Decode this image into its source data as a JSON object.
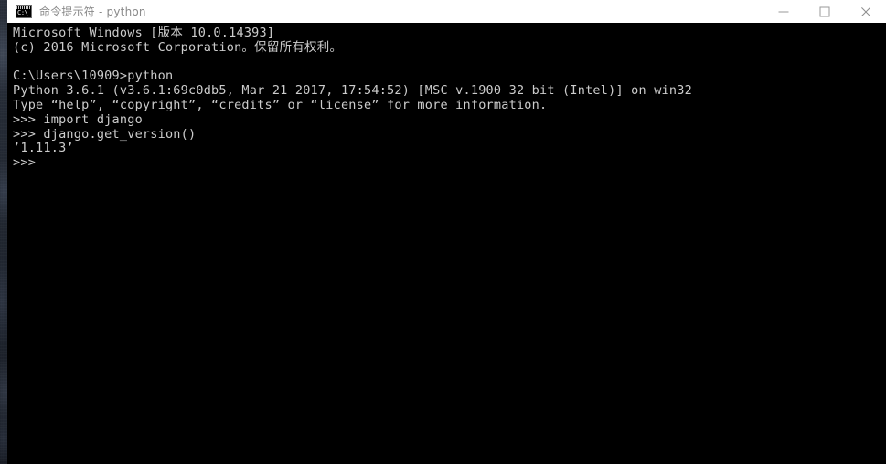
{
  "window": {
    "title": "命令提示符 - python",
    "icon_name": "cmd-icon",
    "icon_text": "C:\\",
    "titlebar_bg": "#ffffff",
    "title_color": "#8a8a8a",
    "console_bg": "#000000",
    "console_fg": "#cccccc"
  },
  "window_controls": [
    {
      "name": "minimize-button",
      "glyph": "minimize-icon",
      "label": "最小化"
    },
    {
      "name": "maximize-button",
      "glyph": "maximize-icon",
      "label": "最大化"
    },
    {
      "name": "close-button",
      "glyph": "close-icon",
      "label": "关闭"
    }
  ],
  "console": {
    "lines": [
      "Microsoft Windows [版本 10.0.14393]",
      "(c) 2016 Microsoft Corporation。保留所有权利。",
      "",
      "C:\\Users\\10909>python",
      "Python 3.6.1 (v3.6.1:69c0db5, Mar 21 2017, 17:54:52) [MSC v.1900 32 bit (Intel)] on win32",
      "Type “help”, “copyright”, “credits” or “license” for more information.",
      ">>> import django",
      ">>> django.get_version()",
      "’1.11.3’",
      ">>>"
    ]
  }
}
